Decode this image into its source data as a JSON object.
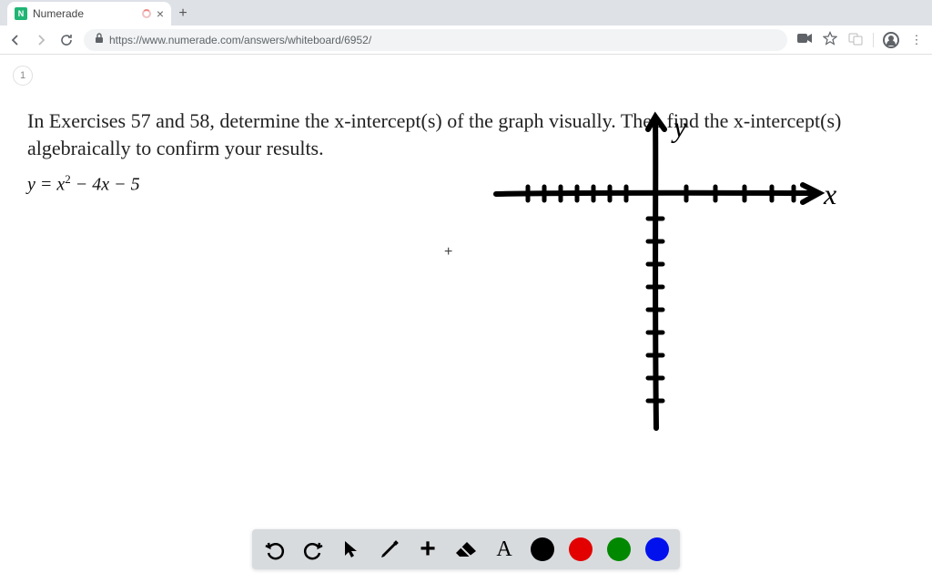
{
  "browser": {
    "tab_title": "Numerade",
    "tab_favicon": "N",
    "close_glyph": "×",
    "newtab_glyph": "+",
    "url": "https://www.numerade.com/answers/whiteboard/6952/",
    "nav": {
      "back": "←",
      "forward": "→",
      "reload": "↻"
    },
    "icons": {
      "camera": "■",
      "star": "☆",
      "menu": "⋮"
    }
  },
  "page": {
    "indicator": "1",
    "question": "In Exercises 57 and 58, determine the x-intercept(s) of the graph visually. Then find the x-intercept(s) algebraically to confirm your results.",
    "equation_parts": {
      "lhs": "y = x",
      "sup": "2",
      "rhs": " − 4x − 5"
    },
    "axis_labels": {
      "x": "x",
      "y": "y"
    },
    "plus_marker": "+"
  },
  "toolbar": {
    "undo": "↶",
    "redo": "↷",
    "pointer": "➤",
    "pencil": "✎",
    "plus": "+",
    "eraser": "▰",
    "text": "A",
    "colors": [
      "black",
      "red",
      "green",
      "blue"
    ]
  }
}
